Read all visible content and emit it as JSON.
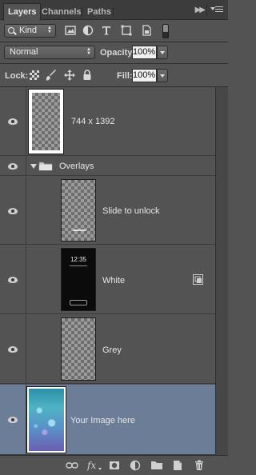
{
  "tabs": [
    {
      "label": "Layers",
      "active": true
    },
    {
      "label": "Channels",
      "active": false
    },
    {
      "label": "Paths",
      "active": false
    }
  ],
  "filter": {
    "kind_label": "Kind",
    "icons": [
      "image-filter-icon",
      "adjustment-filter-icon",
      "type-filter-icon",
      "shape-filter-icon",
      "smart-object-filter-icon"
    ]
  },
  "blend": {
    "mode": "Normal",
    "opacity_label": "Opacity:",
    "opacity_value": "100%",
    "fill_label": "Fill:",
    "fill_value": "100%",
    "lock_label": "Lock:"
  },
  "layers": [
    {
      "name": "744 x 1392",
      "type": "layer",
      "visible": true
    },
    {
      "name": "Overlays",
      "type": "group",
      "visible": true,
      "expanded": true
    },
    {
      "name": "Slide to unlock",
      "type": "layer",
      "visible": true
    },
    {
      "name": "White",
      "type": "smart-object",
      "visible": true,
      "thumb_time": "12:35"
    },
    {
      "name": "Grey",
      "type": "layer",
      "visible": true
    },
    {
      "name": "Your Image here",
      "type": "layer",
      "visible": true,
      "selected": true
    }
  ],
  "colors": {
    "panel": "#535353",
    "selection": "#6c7d97",
    "tabbar": "#3c3c3c"
  }
}
